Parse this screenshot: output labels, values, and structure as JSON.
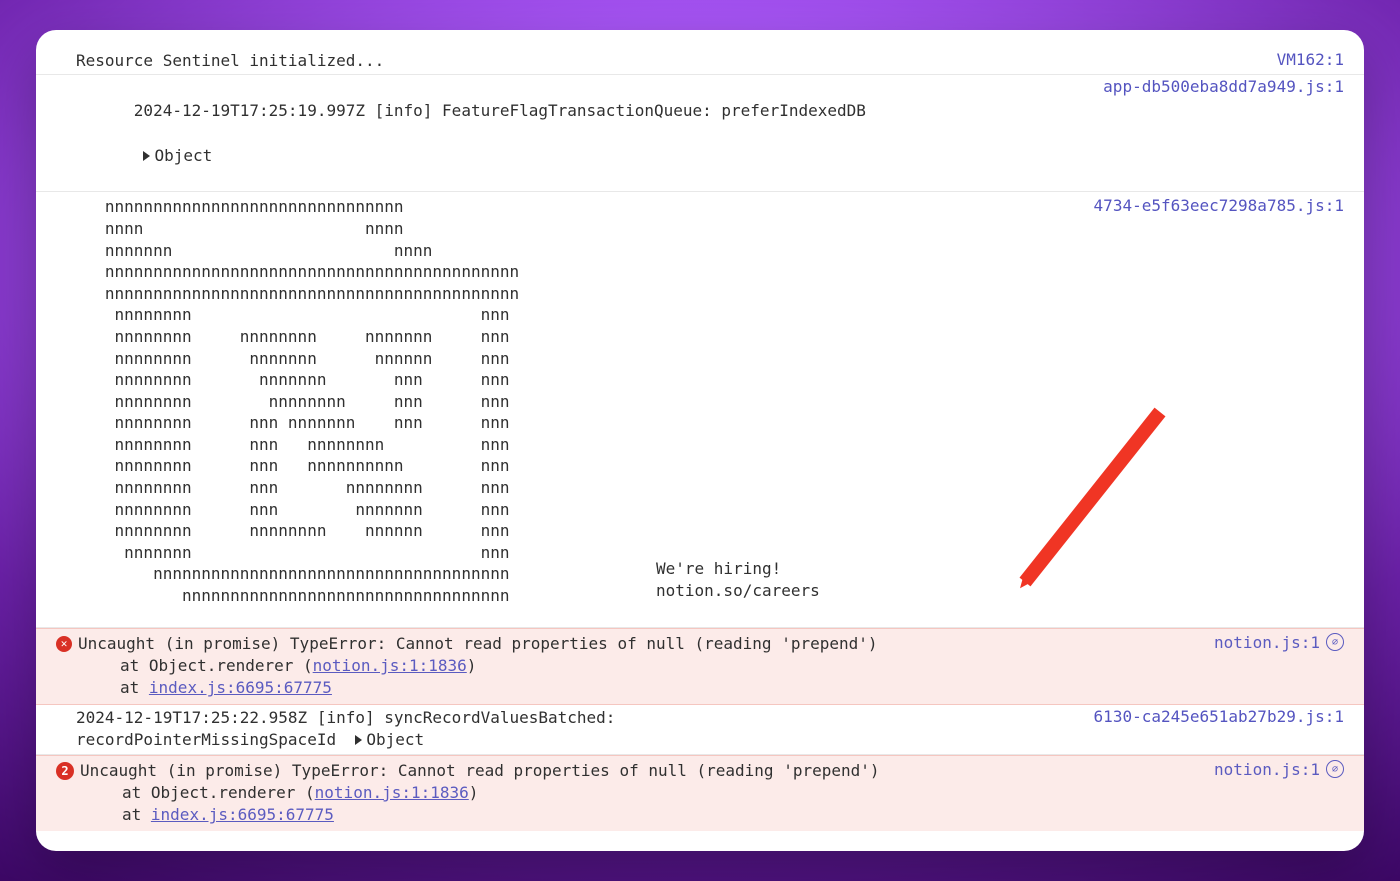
{
  "logs": {
    "row1": {
      "msg": "Resource Sentinel initialized...",
      "source": "VM162:1"
    },
    "row2": {
      "msg": "2024-12-19T17:25:19.997Z [info] FeatureFlagTransactionQueue: preferIndexedDB",
      "object_label": "Object",
      "source": "app-db500eba8dd7a949.js:1"
    },
    "ascii": {
      "source": "4734-e5f63eec7298a785.js:1",
      "art": "   nnnnnnnnnnnnnnnnnnnnnnnnnnnnnnn\n   nnnn                       nnnn\n   nnnnnnn                       nnnn\n   nnnnnnnnnnnnnnnnnnnnnnnnnnnnnnnnnnnnnnnnnnn\n   nnnnnnnnnnnnnnnnnnnnnnnnnnnnnnnnnnnnnnnnnnn\n    nnnnnnnn                              nnn\n    nnnnnnnn     nnnnnnnn     nnnnnnn     nnn\n    nnnnnnnn      nnnnnnn      nnnnnn     nnn\n    nnnnnnnn       nnnnnnn       nnn      nnn\n    nnnnnnnn        nnnnnnnn     nnn      nnn\n    nnnnnnnn      nnn nnnnnnn    nnn      nnn\n    nnnnnnnn      nnn   nnnnnnnn          nnn\n    nnnnnnnn      nnn   nnnnnnnnnn        nnn\n    nnnnnnnn      nnn       nnnnnnnn      nnn\n    nnnnnnnn      nnn        nnnnnnn      nnn\n    nnnnnnnn      nnnnnnnn    nnnnnn      nnn\n     nnnnnnn                              nnn\n        nnnnnnnnnnnnnnnnnnnnnnnnnnnnnnnnnnnnn\n           nnnnnnnnnnnnnnnnnnnnnnnnnnnnnnnnnn",
      "hiring": "We're hiring!\nnotion.so/careers"
    },
    "error1": {
      "icon": "✕",
      "msg": "Uncaught (in promise) TypeError: Cannot read properties of null (reading 'prepend')",
      "stack_at1": "at Object.renderer (",
      "stack_link1": "notion.js:1:1836",
      "stack_close1": ")",
      "stack_at2": "at ",
      "stack_link2": "index.js:6695:67775",
      "source": "notion.js:1"
    },
    "row3": {
      "msg": "2024-12-19T17:25:22.958Z [info] syncRecordValuesBatched:\nrecordPointerMissingSpaceId  ",
      "object_label": "Object",
      "source": "6130-ca245e651ab27b29.js:1"
    },
    "error2": {
      "count": "2",
      "msg": "Uncaught (in promise) TypeError: Cannot read properties of null (reading 'prepend')",
      "stack_at1": "at Object.renderer (",
      "stack_link1": "notion.js:1:1836",
      "stack_close1": ")",
      "stack_at2": "at ",
      "stack_link2": "index.js:6695:67775",
      "source": "notion.js:1"
    }
  },
  "src_badge_glyph": "⌀"
}
